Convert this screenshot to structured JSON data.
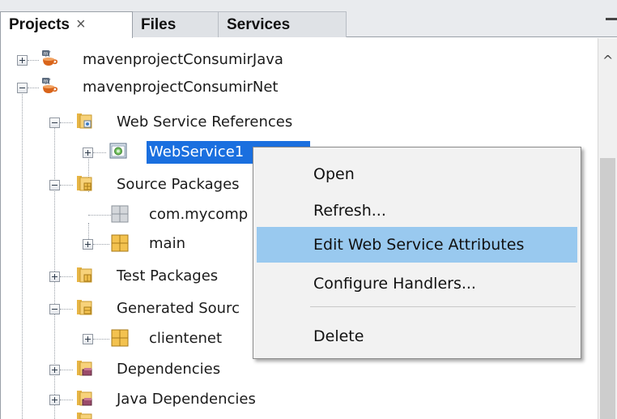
{
  "tabs": [
    {
      "label": "Projects",
      "close": "×"
    },
    {
      "label": "Files"
    },
    {
      "label": "Services"
    }
  ],
  "tree": {
    "items": [
      {
        "label": "mavenprojectConsumirJava",
        "icon": "maven-project-icon",
        "expanded": false
      },
      {
        "label": "mavenprojectConsumirNet",
        "icon": "maven-project-icon",
        "expanded": true
      },
      {
        "label": "Web Service References",
        "icon": "web-service-references-folder-icon",
        "expanded": true
      },
      {
        "label": "WebService1",
        "icon": "web-service-icon",
        "expanded": false,
        "selected": true
      },
      {
        "label": "Source Packages",
        "icon": "source-packages-folder-icon",
        "expanded": true
      },
      {
        "label": "com.mycomp",
        "icon": "package-icon"
      },
      {
        "label": "main",
        "icon": "package-icon",
        "expanded": false
      },
      {
        "label": "Test Packages",
        "icon": "test-packages-folder-icon",
        "expanded": false
      },
      {
        "label": "Generated Sourc",
        "icon": "generated-sources-folder-icon",
        "expanded": true
      },
      {
        "label": "clientenet",
        "icon": "package-icon",
        "expanded": false
      },
      {
        "label": "Dependencies",
        "icon": "dependencies-folder-icon",
        "expanded": false
      },
      {
        "label": "Java Dependencies",
        "icon": "dependencies-folder-icon",
        "expanded": false
      }
    ]
  },
  "context_menu": {
    "items": [
      {
        "label": "Open"
      },
      {
        "label": "Refresh..."
      },
      {
        "label": "Edit Web Service Attributes",
        "highlighted": true
      },
      {
        "label": "Configure Handlers..."
      },
      {
        "label": "Delete"
      }
    ]
  },
  "colors": {
    "selection": "#1a6fdf",
    "menu_highlight": "#99c9ef",
    "menu_background": "#f2f2f2"
  }
}
